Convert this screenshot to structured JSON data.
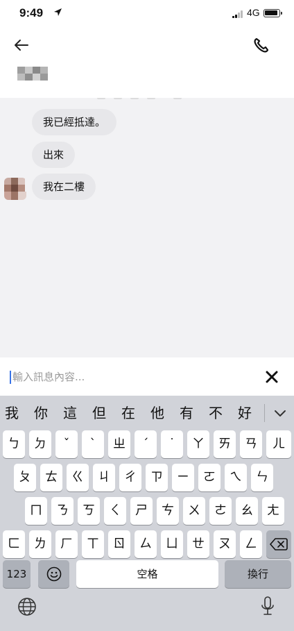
{
  "status_bar": {
    "time": "9:49",
    "location_icon": "location-arrow-icon",
    "network": "4G",
    "battery_icon": "battery-icon"
  },
  "header": {
    "back_icon": "back-arrow-icon",
    "call_icon": "phone-icon",
    "contact_name": "(blurred name)"
  },
  "messages": [
    {
      "text": "我已經抵達。"
    },
    {
      "text": "出來"
    },
    {
      "text": "我在二樓"
    }
  ],
  "input": {
    "placeholder": "輸入訊息內容...",
    "value": "",
    "clear_icon": "close-icon"
  },
  "keyboard": {
    "candidates": [
      "我",
      "你",
      "這",
      "但",
      "在",
      "他",
      "有",
      "不",
      "好"
    ],
    "expand_icon": "chevron-down-icon",
    "rows": [
      [
        "ㄅ",
        "ㄉ",
        "ˇ",
        "ˋ",
        "ㄓ",
        "ˊ",
        "˙",
        "ㄚ",
        "ㄞ",
        "ㄢ",
        "ㄦ"
      ],
      [
        "ㄆ",
        "ㄊ",
        "ㄍ",
        "ㄐ",
        "ㄔ",
        "ㄗ",
        "ㄧ",
        "ㄛ",
        "ㄟ",
        "ㄣ"
      ],
      [
        "ㄇ",
        "ㄋ",
        "ㄎ",
        "ㄑ",
        "ㄕ",
        "ㄘ",
        "ㄨ",
        "ㄜ",
        "ㄠ",
        "ㄤ"
      ],
      [
        "ㄈ",
        "ㄌ",
        "ㄏ",
        "ㄒ",
        "ㄖ",
        "ㄙ",
        "ㄩ",
        "ㄝ",
        "ㄡ",
        "ㄥ"
      ]
    ],
    "delete_icon": "backspace-icon",
    "numbers_key": "123",
    "emoji_icon": "emoji-icon",
    "space_key": "空格",
    "return_key": "換行",
    "globe_icon": "globe-icon",
    "mic_icon": "microphone-icon"
  },
  "colors": {
    "chat_background": "#f2f2f4",
    "bubble": "#e7e7ea",
    "keyboard_background": "#d1d3d9",
    "key": "#ffffff",
    "caret": "#3a74e6"
  }
}
